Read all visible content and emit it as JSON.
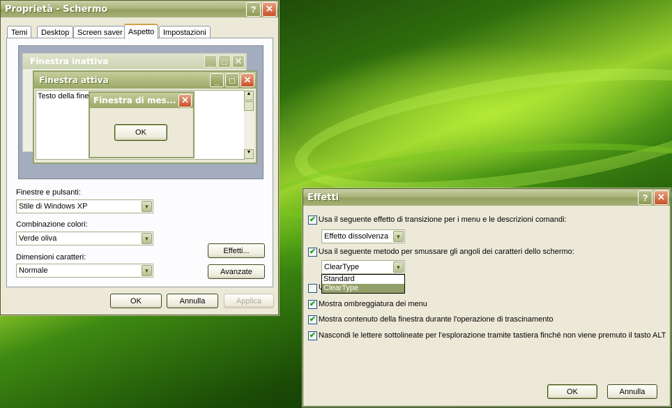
{
  "props": {
    "title": "Proprietà - Schermo",
    "tabs": [
      "Temi",
      "Desktop",
      "Screen saver",
      "Aspetto",
      "Impostazioni"
    ],
    "preview": {
      "inactive_title": "Finestra inattiva",
      "active_title": "Finestra attiva",
      "window_text": "Testo della finestra",
      "message_title": "Finestra di mes...",
      "ok_label": "OK"
    },
    "fields": {
      "windows_buttons_label": "Finestre e pulsanti:",
      "windows_buttons_value": "Stile di Windows XP",
      "color_scheme_label": "Combinazione colori:",
      "color_scheme_value": "Verde oliva",
      "font_size_label": "Dimensioni caratteri:",
      "font_size_value": "Normale"
    },
    "buttons": {
      "effects": "Effetti...",
      "advanced": "Avanzate",
      "ok": "OK",
      "cancel": "Annulla",
      "apply": "Applica"
    }
  },
  "effects": {
    "title": "Effetti",
    "opt1": "Usa il seguente effetto di transizione per i menu e le descrizioni comandi:",
    "opt1_value": "Effetto dissolvenza",
    "opt2": "Usa il seguente metodo per smussare gli angoli dei caratteri dello schermo:",
    "opt2_value": "ClearType",
    "dropdown_options": [
      "Standard",
      "ClearType"
    ],
    "opt3_partial": "U",
    "opt4": "Mostra ombreggiatura dei menu",
    "opt5": "Mostra contenuto della finestra durante l'operazione di trascinamento",
    "opt6": "Nascondi le lettere sottolineate per l'esplorazione tramite tastiera finché non viene premuto il tasto ALT",
    "ok": "OK",
    "cancel": "Annulla"
  },
  "glyphs": {
    "help": "?",
    "close": "✕",
    "minimize": "_",
    "maximize": "□",
    "check": "✔",
    "dropdown": "▼",
    "scroll_up": "▲",
    "scroll_down": "▼"
  }
}
